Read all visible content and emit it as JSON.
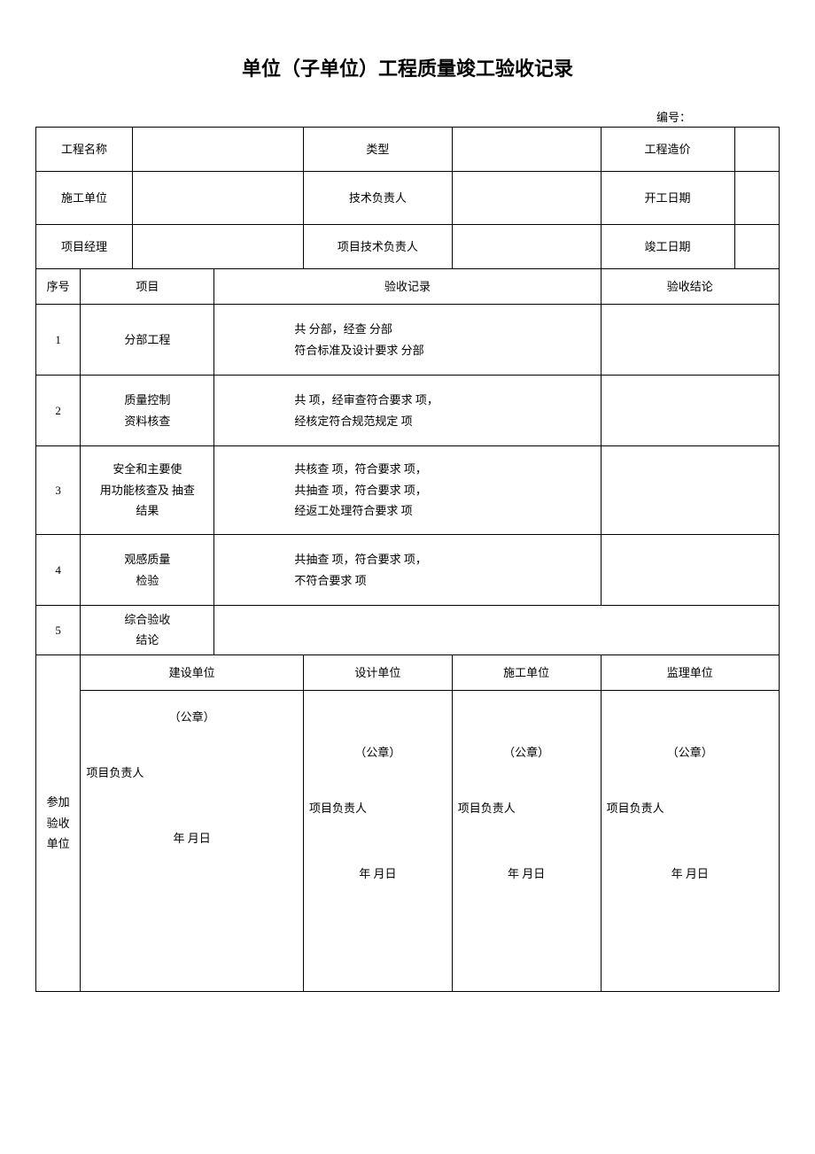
{
  "title": "单位（子单位）工程质量竣工验收记录",
  "doc_num_label": "编号：",
  "header": {
    "r1": {
      "c1": "工程名称",
      "c2": "类型",
      "c3": "工程造价"
    },
    "r2": {
      "c1": "施工单位",
      "c2": "技术负责人",
      "c3": "开工日期"
    },
    "r3": {
      "c1": "项目经理",
      "c2": "项目技术负责人",
      "c3": "竣工日期"
    }
  },
  "cols": {
    "seq": "序号",
    "item": "项目",
    "record": "验收记录",
    "concl": "验收结论"
  },
  "rows": [
    {
      "seq": "1",
      "item": "分部工程",
      "record": "共  分部，经查            分部\n符合标准及设计要求        分部"
    },
    {
      "seq": "2",
      "item": "质量控制\n资料核查",
      "record": "共  项，经审查符合要求        项，\n经核定符合规范规定      项"
    },
    {
      "seq": "3",
      "item": "安全和主要使\n用功能核查及 抽查\n结果",
      "record": "共核查  项，符合要求        项，\n共抽查  项，符合要求        项，\n经返工处理符合要求      项"
    },
    {
      "seq": "4",
      "item": "观感质量\n检验",
      "record": "共抽查  项，符合要求        项，\n不符合要求      项"
    },
    {
      "seq": "5",
      "item": "综合验收\n结论",
      "record": ""
    }
  ],
  "sig": {
    "side": "参加\n验收\n单位",
    "heads": [
      "建设单位",
      "设计单位",
      "施工单位",
      "监理单位"
    ],
    "seal": "（公章）",
    "person": "项目负责人",
    "date": "年  月日"
  }
}
